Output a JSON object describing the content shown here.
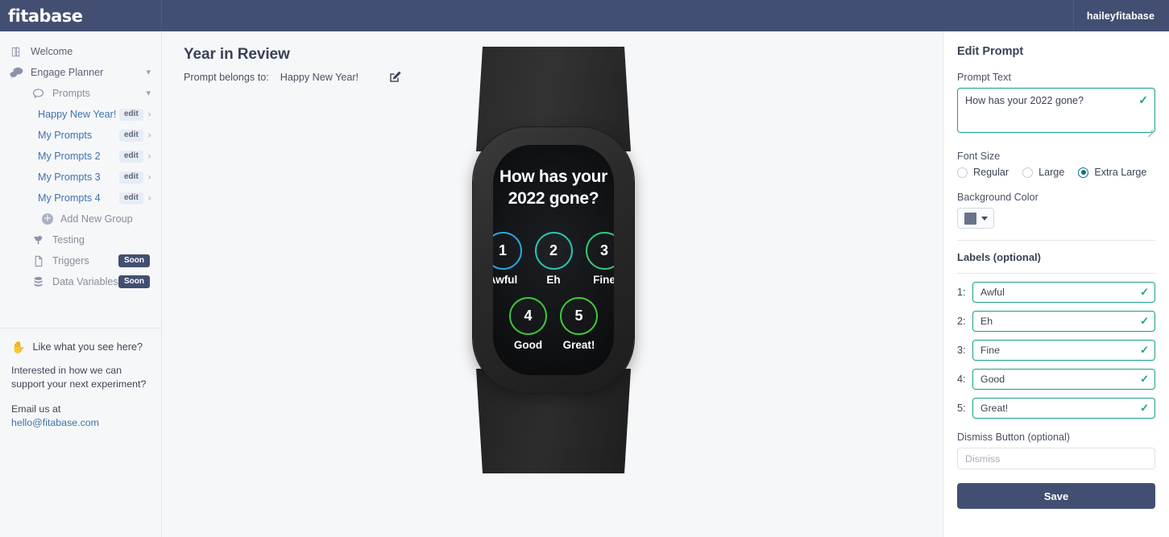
{
  "topbar": {
    "logo": "fitabase",
    "user": "haileyfitabase"
  },
  "sidebar": {
    "items": [
      {
        "label": "Welcome",
        "icon": "door-icon"
      },
      {
        "label": "Engage Planner",
        "icon": "chats-icon"
      },
      {
        "label": "Prompts",
        "icon": "chat-bubble-icon"
      }
    ],
    "prompt_groups": [
      {
        "label": "Happy New Year!",
        "edit": "edit"
      },
      {
        "label": "My Prompts",
        "edit": "edit"
      },
      {
        "label": "My Prompts 2",
        "edit": "edit"
      },
      {
        "label": "My Prompts 3",
        "edit": "edit"
      },
      {
        "label": "My Prompts 4",
        "edit": "edit"
      }
    ],
    "add_new_group": "Add New Group",
    "lower_items": [
      {
        "label": "Testing",
        "icon": "mortar-icon",
        "badge": ""
      },
      {
        "label": "Triggers",
        "icon": "document-icon",
        "badge": "Soon"
      },
      {
        "label": "Data Variables",
        "icon": "database-icon",
        "badge": "Soon"
      }
    ],
    "promo": {
      "heading": "Like what you see here?",
      "body": "Interested in how we can support your next experiment?",
      "email_prefix": "Email us at ",
      "email": "hello@fitabase.com"
    }
  },
  "main": {
    "title": "Year in Review",
    "belongs_label": "Prompt belongs to:",
    "belongs_value": "Happy New Year!",
    "edit_icon": "pencil-square-icon"
  },
  "preview": {
    "question": "How has your 2022 gone?",
    "options": [
      {
        "number": "1",
        "label": "Awful",
        "color": "#2aa7e0"
      },
      {
        "number": "2",
        "label": "Eh",
        "color": "#2ac4b2"
      },
      {
        "number": "3",
        "label": "Fine",
        "color": "#33c874"
      },
      {
        "number": "4",
        "label": "Good",
        "color": "#3cc83c"
      },
      {
        "number": "5",
        "label": "Great!",
        "color": "#3ecb34"
      }
    ]
  },
  "panel": {
    "title": "Edit Prompt",
    "prompt_text_label": "Prompt Text",
    "prompt_text_value": "How has your 2022 gone?",
    "font_size_label": "Font Size",
    "font_size_options": [
      {
        "label": "Regular",
        "selected": false
      },
      {
        "label": "Large",
        "selected": false
      },
      {
        "label": "Extra Large",
        "selected": true
      }
    ],
    "background_color_label": "Background Color",
    "background_color_value": "#67748c",
    "labels_section_title": "Labels (optional)",
    "labels": [
      {
        "num": "1:",
        "value": "Awful"
      },
      {
        "num": "2:",
        "value": "Eh"
      },
      {
        "num": "3:",
        "value": "Fine"
      },
      {
        "num": "4:",
        "value": "Good"
      },
      {
        "num": "5:",
        "value": "Great!"
      }
    ],
    "dismiss_label": "Dismiss Button (optional)",
    "dismiss_placeholder": "Dismiss",
    "dismiss_value": "",
    "save_label": "Save"
  }
}
